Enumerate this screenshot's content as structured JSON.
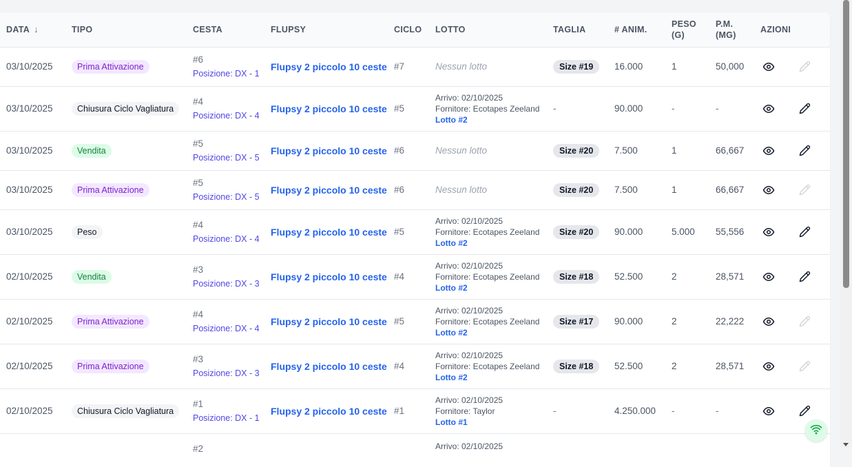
{
  "header": {
    "data": "DATA",
    "tipo": "TIPO",
    "cesta": "CESTA",
    "flupsy": "FLUPSY",
    "ciclo": "CICLO",
    "lotto": "LOTTO",
    "taglia": "TAGLIA",
    "animali": "# ANIM.",
    "peso_1": "PESO",
    "peso_2": "(G)",
    "pm_1": "P.M.",
    "pm_2": "(MG)",
    "azioni": "AZIONI"
  },
  "rows": [
    {
      "date": "03/10/2025",
      "tipo": "Prima Attivazione",
      "cesta": "#6",
      "posizione": "Posizione: DX - 1",
      "flupsy": "Flupsy 2 piccolo 10 ceste",
      "ciclo": "#7",
      "lotto_empty": "Nessun lotto",
      "taglia": "Size #19",
      "animali": "16.000",
      "peso": "1",
      "pm": "50,000"
    },
    {
      "date": "03/10/2025",
      "tipo": "Chiusura Ciclo Vagliatura",
      "cesta": "#4",
      "posizione": "Posizione: DX - 4",
      "flupsy": "Flupsy 2 piccolo 10 ceste",
      "ciclo": "#5",
      "arrivo": "Arrivo: 02/10/2025",
      "fornitore": "Fornitore: Ecotapes Zeeland",
      "lotto_link": "Lotto #2",
      "taglia_dash": "-",
      "animali": "90.000",
      "peso": "-",
      "pm": "-"
    },
    {
      "date": "03/10/2025",
      "tipo": "Vendita",
      "cesta": "#5",
      "posizione": "Posizione: DX - 5",
      "flupsy": "Flupsy 2 piccolo 10 ceste",
      "ciclo": "#6",
      "lotto_empty": "Nessun lotto",
      "taglia": "Size #20",
      "animali": "7.500",
      "peso": "1",
      "pm": "66,667"
    },
    {
      "date": "03/10/2025",
      "tipo": "Prima Attivazione",
      "cesta": "#5",
      "posizione": "Posizione: DX - 5",
      "flupsy": "Flupsy 2 piccolo 10 ceste",
      "ciclo": "#6",
      "lotto_empty": "Nessun lotto",
      "taglia": "Size #20",
      "animali": "7.500",
      "peso": "1",
      "pm": "66,667"
    },
    {
      "date": "03/10/2025",
      "tipo": "Peso",
      "cesta": "#4",
      "posizione": "Posizione: DX - 4",
      "flupsy": "Flupsy 2 piccolo 10 ceste",
      "ciclo": "#5",
      "arrivo": "Arrivo: 02/10/2025",
      "fornitore": "Fornitore: Ecotapes Zeeland",
      "lotto_link": "Lotto #2",
      "taglia": "Size #20",
      "animali": "90.000",
      "peso": "5.000",
      "pm": "55,556"
    },
    {
      "date": "02/10/2025",
      "tipo": "Vendita",
      "cesta": "#3",
      "posizione": "Posizione: DX - 3",
      "flupsy": "Flupsy 2 piccolo 10 ceste",
      "ciclo": "#4",
      "arrivo": "Arrivo: 02/10/2025",
      "fornitore": "Fornitore: Ecotapes Zeeland",
      "lotto_link": "Lotto #2",
      "taglia": "Size #18",
      "animali": "52.500",
      "peso": "2",
      "pm": "28,571"
    },
    {
      "date": "02/10/2025",
      "tipo": "Prima Attivazione",
      "cesta": "#4",
      "posizione": "Posizione: DX - 4",
      "flupsy": "Flupsy 2 piccolo 10 ceste",
      "ciclo": "#5",
      "arrivo": "Arrivo: 02/10/2025",
      "fornitore": "Fornitore: Ecotapes Zeeland",
      "lotto_link": "Lotto #2",
      "taglia": "Size #17",
      "animali": "90.000",
      "peso": "2",
      "pm": "22,222"
    },
    {
      "date": "02/10/2025",
      "tipo": "Prima Attivazione",
      "cesta": "#3",
      "posizione": "Posizione: DX - 3",
      "flupsy": "Flupsy 2 piccolo 10 ceste",
      "ciclo": "#4",
      "arrivo": "Arrivo: 02/10/2025",
      "fornitore": "Fornitore: Ecotapes Zeeland",
      "lotto_link": "Lotto #2",
      "taglia": "Size #18",
      "animali": "52.500",
      "peso": "2",
      "pm": "28,571"
    },
    {
      "date": "02/10/2025",
      "tipo": "Chiusura Ciclo Vagliatura",
      "cesta": "#1",
      "posizione": "Posizione: DX - 1",
      "flupsy": "Flupsy 2 piccolo 10 ceste",
      "ciclo": "#1",
      "arrivo": "Arrivo: 02/10/2025",
      "fornitore": "Fornitore: Taylor",
      "lotto_link": "Lotto #1",
      "taglia_dash": "-",
      "animali": "4.250.000",
      "peso": "-",
      "pm": "-"
    },
    {
      "cesta": "#2",
      "arrivo": "Arrivo: 02/10/2025"
    }
  ],
  "colors": {
    "prima_attivazione": "#7e22ce",
    "vendita": "#15803d",
    "link": "#2563eb",
    "posizione": "#4f46e5"
  },
  "icons": {
    "sort": "arrow-down-icon",
    "view": "eye-icon",
    "edit": "pencil-icon",
    "status": "wifi-icon"
  }
}
